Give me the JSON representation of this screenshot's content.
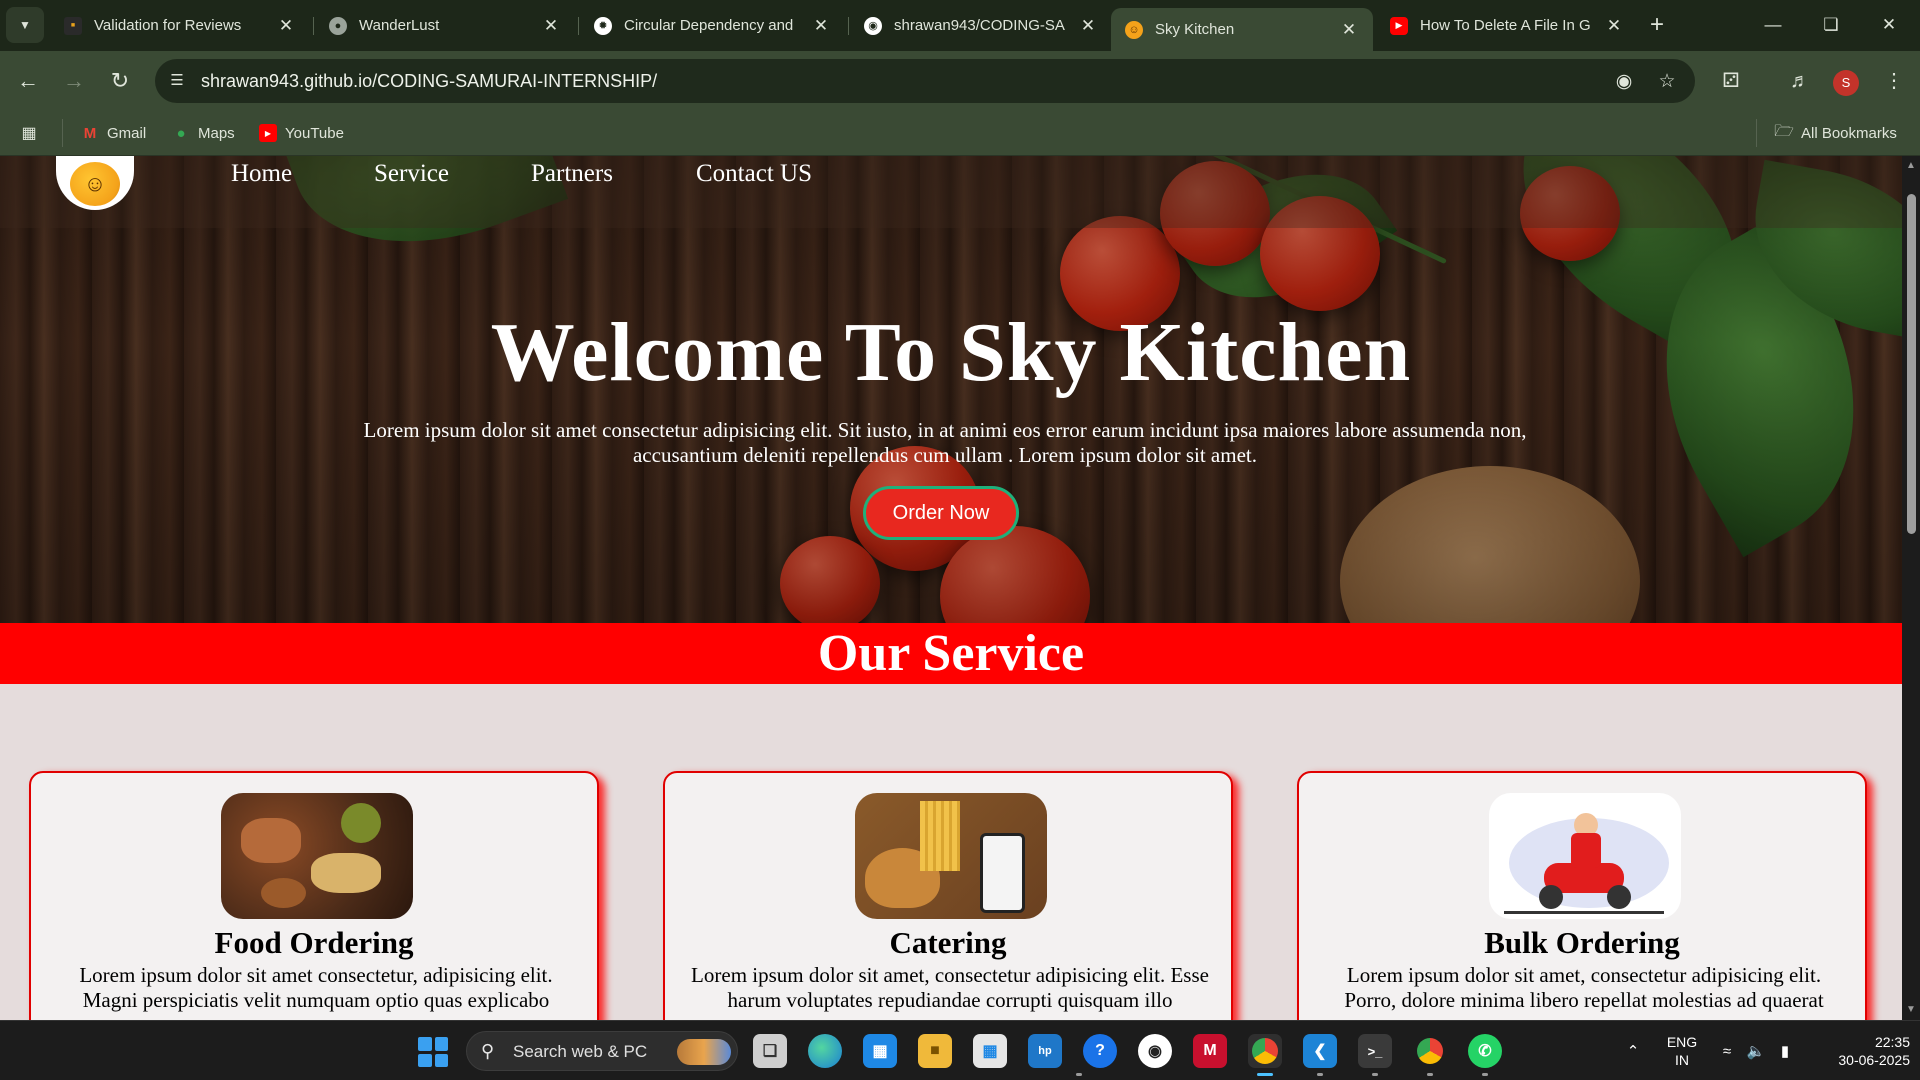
{
  "browser": {
    "tabs": [
      {
        "title": "Validation for Reviews",
        "favicon_color": "#e8a21b",
        "active": false
      },
      {
        "title": "WanderLust",
        "favicon_color": "#9aa39a",
        "active": false
      },
      {
        "title": "Circular Dependency and",
        "favicon_color": "#ffffff",
        "active": false
      },
      {
        "title": "shrawan943/CODING-SA",
        "favicon_color": "#ffffff",
        "active": false
      },
      {
        "title": "Sky Kitchen",
        "favicon_color": "#f4a21a",
        "active": true
      },
      {
        "title": "How To Delete A File In G",
        "favicon_color": "#ff0000",
        "active": false
      }
    ],
    "new_tab_label": "+",
    "url": "shrawan943.github.io/CODING-SAMURAI-INTERNSHIP/",
    "profile_initial": "S",
    "bookmarks": [
      {
        "label": "Gmail",
        "icon": "gmail-icon"
      },
      {
        "label": "Maps",
        "icon": "maps-icon"
      },
      {
        "label": "YouTube",
        "icon": "youtube-icon"
      }
    ],
    "all_bookmarks_label": "All Bookmarks"
  },
  "site": {
    "nav": [
      "Home",
      "Service",
      "Partners",
      "Contact US"
    ],
    "hero": {
      "title": "Welcome To Sky Kitchen",
      "text": "Lorem ipsum dolor sit amet consectetur adipisicing elit. Sit iusto, in at animi eos error earum incidunt ipsa maiores labore assumenda non, accusantium deleniti repellendus cum ullam . Lorem ipsum dolor sit amet.",
      "cta": "Order Now"
    },
    "service_heading": "Our Service",
    "cards": [
      {
        "title": "Food Ordering",
        "text": "Lorem ipsum dolor sit amet consectetur, adipisicing elit. Magni perspiciatis velit numquam optio quas explicabo"
      },
      {
        "title": "Catering",
        "text": "Lorem ipsum dolor sit amet, consectetur adipisicing elit. Esse harum voluptates repudiandae corrupti quisquam illo"
      },
      {
        "title": "Bulk Ordering",
        "text": "Lorem ipsum dolor sit amet, consectetur adipisicing elit. Porro, dolore minima libero repellat molestias ad quaerat"
      }
    ],
    "accent_red": "#ff0000",
    "accent_green": "#1fb07a"
  },
  "taskbar": {
    "search_placeholder": "Search web & PC",
    "lang_line1": "ENG",
    "lang_line2": "IN",
    "time": "22:35",
    "date": "30-06-2025"
  }
}
